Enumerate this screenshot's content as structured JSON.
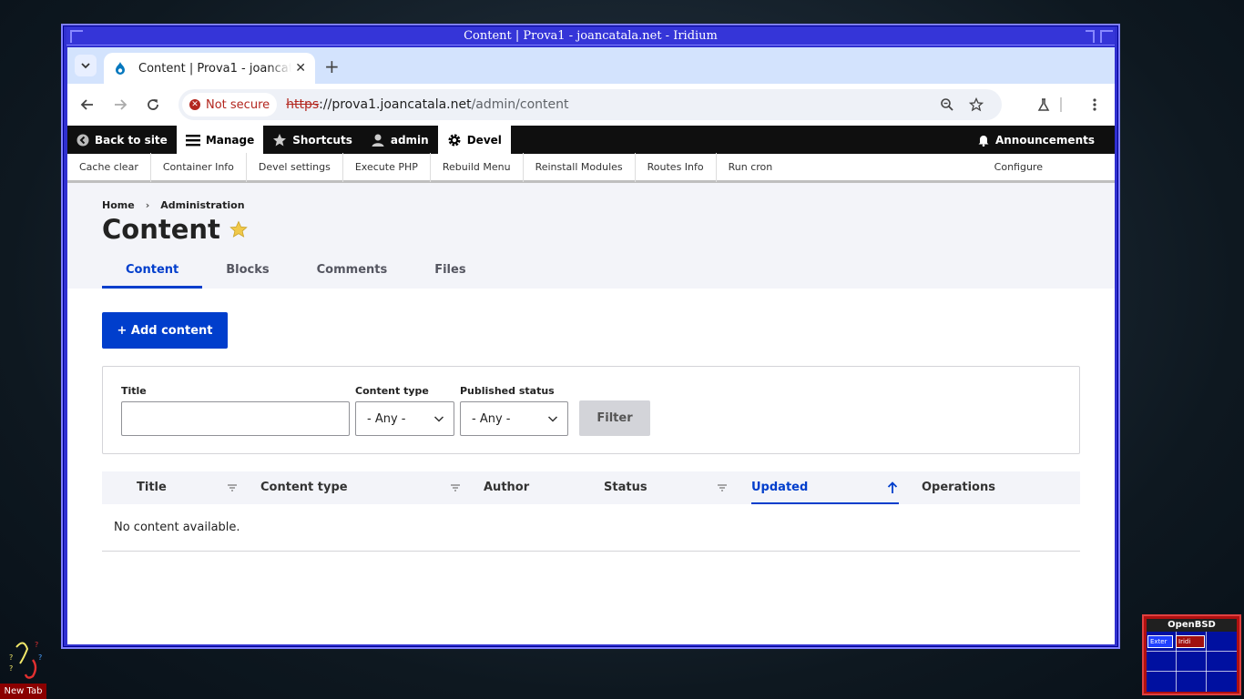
{
  "window": {
    "title": "Content | Prova1 - joancatala.net - Iridium"
  },
  "browser": {
    "tab_title": "Content | Prova1 - joancatala.net - Iridium",
    "security_label": "Not secure",
    "url_scheme": "https",
    "url_host": "://prova1.joancatala.net",
    "url_path": "/admin/content"
  },
  "admin_toolbar": {
    "back_to_site": "Back to site",
    "manage": "Manage",
    "shortcuts": "Shortcuts",
    "user": "admin",
    "devel": "Devel",
    "announcements": "Announcements"
  },
  "devel_menu": {
    "items": [
      "Cache clear",
      "Container Info",
      "Devel settings",
      "Execute PHP",
      "Rebuild Menu",
      "Reinstall Modules",
      "Routes Info",
      "Run cron"
    ],
    "configure": "Configure"
  },
  "breadcrumb": [
    "Home",
    "Administration"
  ],
  "page_title": "Content",
  "tabs": [
    "Content",
    "Blocks",
    "Comments",
    "Files"
  ],
  "add_content_label": "+ Add content",
  "filters": {
    "title_label": "Title",
    "title_value": "",
    "content_type_label": "Content type",
    "content_type_value": "- Any -",
    "published_label": "Published status",
    "published_value": "- Any -",
    "filter_button": "Filter"
  },
  "table": {
    "columns": [
      "Title",
      "Content type",
      "Author",
      "Status",
      "Updated",
      "Operations"
    ],
    "sorted_column": "Updated",
    "empty_message": "No content available."
  },
  "desktop": {
    "pager_title": "OpenBSD",
    "pager_windows": [
      "Exter",
      "Iridi"
    ],
    "taskbar_item": "New Tab"
  },
  "colors": {
    "accent": "#003ecc",
    "window_frame": "#3030d0",
    "insecure": "#b3261e"
  }
}
